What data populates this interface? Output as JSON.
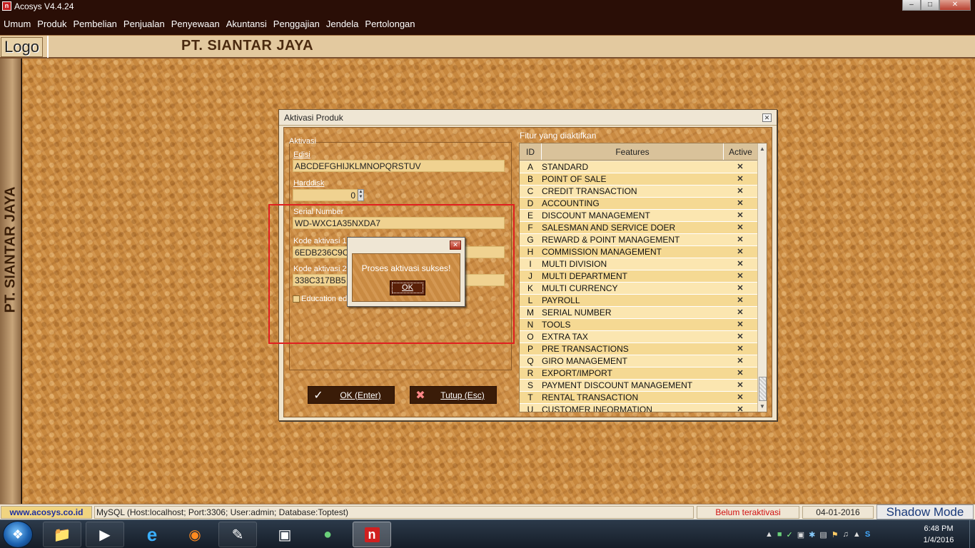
{
  "window": {
    "title": "Acosys V4.4.24",
    "icon": "acosys-app-icon",
    "controls": [
      "minimize",
      "maximize",
      "close"
    ]
  },
  "menu": [
    {
      "label": "Umum"
    },
    {
      "label": "Produk"
    },
    {
      "label": "Pembelian"
    },
    {
      "label": "Penjualan"
    },
    {
      "label": "Penyewaan"
    },
    {
      "label": "Akuntansi"
    },
    {
      "label": "Penggajian"
    },
    {
      "label": "Jendela"
    },
    {
      "label": "Pertolongan"
    }
  ],
  "header": {
    "logo": "Logo",
    "company": "PT. SIANTAR JAYA"
  },
  "side_label": "PT. SIANTAR JAYA",
  "dialog": {
    "title": "Aktivasi Produk",
    "group_title": "Aktivasi",
    "edisi_label": "Edisi",
    "edisi_value": "ABCDEFGHIJKLMNOPQRSTUV",
    "harddisk_label": "Harddisk",
    "harddisk_value": "0",
    "serial_label": "Serial Number",
    "serial_value": "WD-WXC1A35NXDA7",
    "kode1_label": "Kode aktivasi 1",
    "kode1_value": "6EDB236C9C",
    "kode2_label": "Kode aktivasi 2",
    "kode2_value": "338C317BB5",
    "education_label": "Education edition",
    "ok_button": "OK (Enter)",
    "close_button": "Tutup (Esc)",
    "features_title": "Fitur yang diaktifkan",
    "columns": {
      "id": "ID",
      "features": "Features",
      "active": "Active"
    },
    "features": [
      {
        "id": "A",
        "name": "STANDARD",
        "active": "✕"
      },
      {
        "id": "B",
        "name": "POINT OF SALE",
        "active": "✕"
      },
      {
        "id": "C",
        "name": "CREDIT TRANSACTION",
        "active": "✕"
      },
      {
        "id": "D",
        "name": "ACCOUNTING",
        "active": "✕"
      },
      {
        "id": "E",
        "name": "DISCOUNT MANAGEMENT",
        "active": "✕"
      },
      {
        "id": "F",
        "name": "SALESMAN AND SERVICE DOER",
        "active": "✕"
      },
      {
        "id": "G",
        "name": "REWARD & POINT MANAGEMENT",
        "active": "✕"
      },
      {
        "id": "H",
        "name": "COMMISSION MANAGEMENT",
        "active": "✕"
      },
      {
        "id": "I",
        "name": "MULTI DIVISION",
        "active": "✕"
      },
      {
        "id": "J",
        "name": "MULTI DEPARTMENT",
        "active": "✕"
      },
      {
        "id": "K",
        "name": "MULTI CURRENCY",
        "active": "✕"
      },
      {
        "id": "L",
        "name": "PAYROLL",
        "active": "✕"
      },
      {
        "id": "M",
        "name": "SERIAL NUMBER",
        "active": "✕"
      },
      {
        "id": "N",
        "name": "TOOLS",
        "active": "✕"
      },
      {
        "id": "O",
        "name": "EXTRA TAX",
        "active": "✕"
      },
      {
        "id": "P",
        "name": "PRE TRANSACTIONS",
        "active": "✕"
      },
      {
        "id": "Q",
        "name": "GIRO MANAGEMENT",
        "active": "✕"
      },
      {
        "id": "R",
        "name": "EXPORT/IMPORT",
        "active": "✕"
      },
      {
        "id": "S",
        "name": "PAYMENT DISCOUNT MANAGEMENT",
        "active": "✕"
      },
      {
        "id": "T",
        "name": "RENTAL TRANSACTION",
        "active": "✕"
      },
      {
        "id": "U",
        "name": "CUSTOMER INFORMATION",
        "active": "✕"
      }
    ]
  },
  "message_box": {
    "text": "Proses aktivasi sukses!",
    "ok": "OK"
  },
  "status": {
    "website": "www.acosys.co.id",
    "db": "MySQL (Host:localhost; Port:3306; User:admin; Database:Toptest)",
    "activation": "Belum teraktivasi",
    "date": "04-01-2016",
    "shadow": "Shadow Mode"
  },
  "taskbar": {
    "time": "6:48 PM",
    "date": "1/4/2016"
  }
}
